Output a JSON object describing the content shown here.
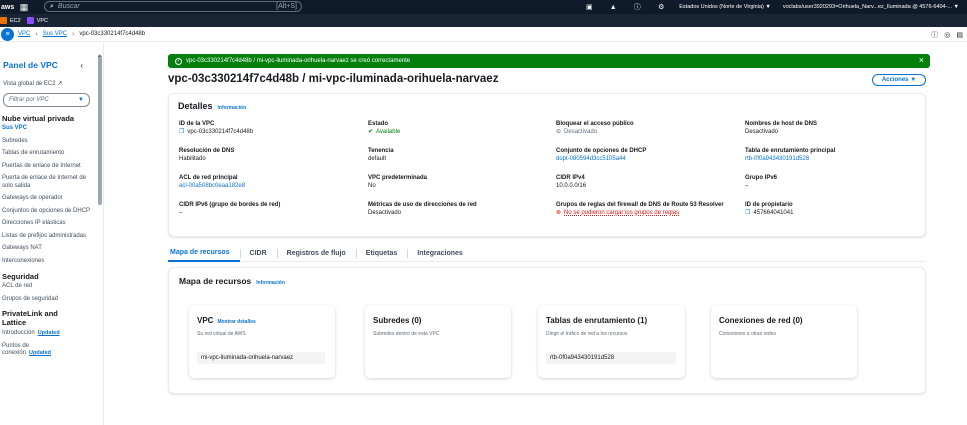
{
  "topbar": {
    "logo": "aws",
    "search_placeholder": "Buscar",
    "search_shortcut": "[Alt+S]",
    "region": "Estados Unidos (Norte de Virginia) ▼",
    "account": "voclabs/user3920293=Orihuela_Narv...ez_Iluminada @ 4576-6404-... ▼"
  },
  "favorites": [
    {
      "label": "EC2",
      "color": "#ed7100"
    },
    {
      "label": "VPC",
      "color": "#8c4fff"
    }
  ],
  "breadcrumb": [
    "VPC",
    "Sus VPC",
    "vpc-03c330214f7c4d48b"
  ],
  "sidebar": {
    "title": "Panel de VPC",
    "global_view": "Vista global de EC2",
    "filter_placeholder": "Filtrar por VPC",
    "sections": [
      {
        "title": "Nube virtual privada",
        "items": [
          {
            "label": "Sus VPC",
            "active": true
          },
          {
            "label": "Subredes"
          },
          {
            "label": "Tablas de enrutamiento"
          },
          {
            "label": "Puertas de enlace de Internet"
          },
          {
            "label": "Puerta de enlace de Internet de solo salida"
          },
          {
            "label": "Gateways de operador"
          },
          {
            "label": "Conjuntos de opciones de DHCP"
          },
          {
            "label": "Direcciones IP elásticas"
          },
          {
            "label": "Listas de prefijos administradas"
          },
          {
            "label": "Gateways NAT"
          },
          {
            "label": "Interconexiones"
          }
        ]
      },
      {
        "title": "Seguridad",
        "items": [
          {
            "label": "ACL de red"
          },
          {
            "label": "Grupos de seguridad"
          }
        ]
      },
      {
        "title": "PrivateLink and Lattice",
        "items": [
          {
            "label": "Introducción",
            "badge": "Updated"
          },
          {
            "label": "Puntos de conexión",
            "badge": "Updated"
          }
        ]
      }
    ]
  },
  "flash": {
    "message": "vpc-03c330214f7c4d48b / mi-vpc-iluminada-orihuela-narvaez se creó correctamente"
  },
  "page": {
    "title": "vpc-03c330214f7c4d48b / mi-vpc-iluminada-orihuela-narvaez",
    "actions_label": "Acciones ▼"
  },
  "details": {
    "title": "Detalles",
    "info": "Información",
    "fields": {
      "vpc_id": {
        "k": "ID de la VPC",
        "v": "vpc-03c330214f7c4d48b"
      },
      "state": {
        "k": "Estado",
        "v": "Available"
      },
      "block_public": {
        "k": "Bloquear el acceso público",
        "v": "Desactivado"
      },
      "dns_hostnames": {
        "k": "Nombres de host de DNS",
        "v": "Desactivado"
      },
      "dns_resolution": {
        "k": "Resolución de DNS",
        "v": "Habilitado"
      },
      "tenancy": {
        "k": "Tenencia",
        "v": "default"
      },
      "dhcp": {
        "k": "Conjunto de opciones de DHCP",
        "v": "dopt-080594d3cc5105a44"
      },
      "main_rt": {
        "k": "Tabla de enrutamiento principal",
        "v": "rtb-0f0a943430191d528"
      },
      "main_acl": {
        "k": "ACL de red principal",
        "v": "acl-00a508bc0eaa182e8"
      },
      "default_vpc": {
        "k": "VPC predeterminada",
        "v": "No"
      },
      "cidr_ipv4": {
        "k": "CIDR IPv4",
        "v": "10.0.0.0/16"
      },
      "ipv6_group": {
        "k": "Grupo IPv6",
        "v": "–"
      },
      "cidr_ipv6": {
        "k": "CIDR IPv6 (grupo de bordes de red)",
        "v": "–"
      },
      "metrics": {
        "k": "Métricas de uso de direcciones de red",
        "v": "Desactivado"
      },
      "route53": {
        "k": "Grupos de reglas del firewall de DNS de Route 53 Resolver",
        "v": "No se pudieron cargar los grupos de reglas"
      },
      "owner": {
        "k": "ID de propietario",
        "v": "457664041041"
      }
    }
  },
  "tabs": [
    "Mapa de recursos",
    "CIDR",
    "Registros de flujo",
    "Etiquetas",
    "Integraciones"
  ],
  "resource_map": {
    "title": "Mapa de recursos",
    "info": "Información",
    "cards": {
      "vpc": {
        "title": "VPC",
        "link": "Mostrar detalles",
        "subtitle": "Su red virtual de AWS",
        "pill": "mi-vpc-iluminada-orihuela-narvaez"
      },
      "subnets": {
        "title": "Subredes (0)",
        "subtitle": "Subredes dentro de esta VPC"
      },
      "route_tables": {
        "title": "Tablas de enrutamiento (1)",
        "subtitle": "Dirigir el tráfico de red a los recursos",
        "pill": "rtb-0f0a943430191d528"
      },
      "connections": {
        "title": "Conexiones de red (0)",
        "subtitle": "Conexiones a otras redes"
      }
    }
  }
}
